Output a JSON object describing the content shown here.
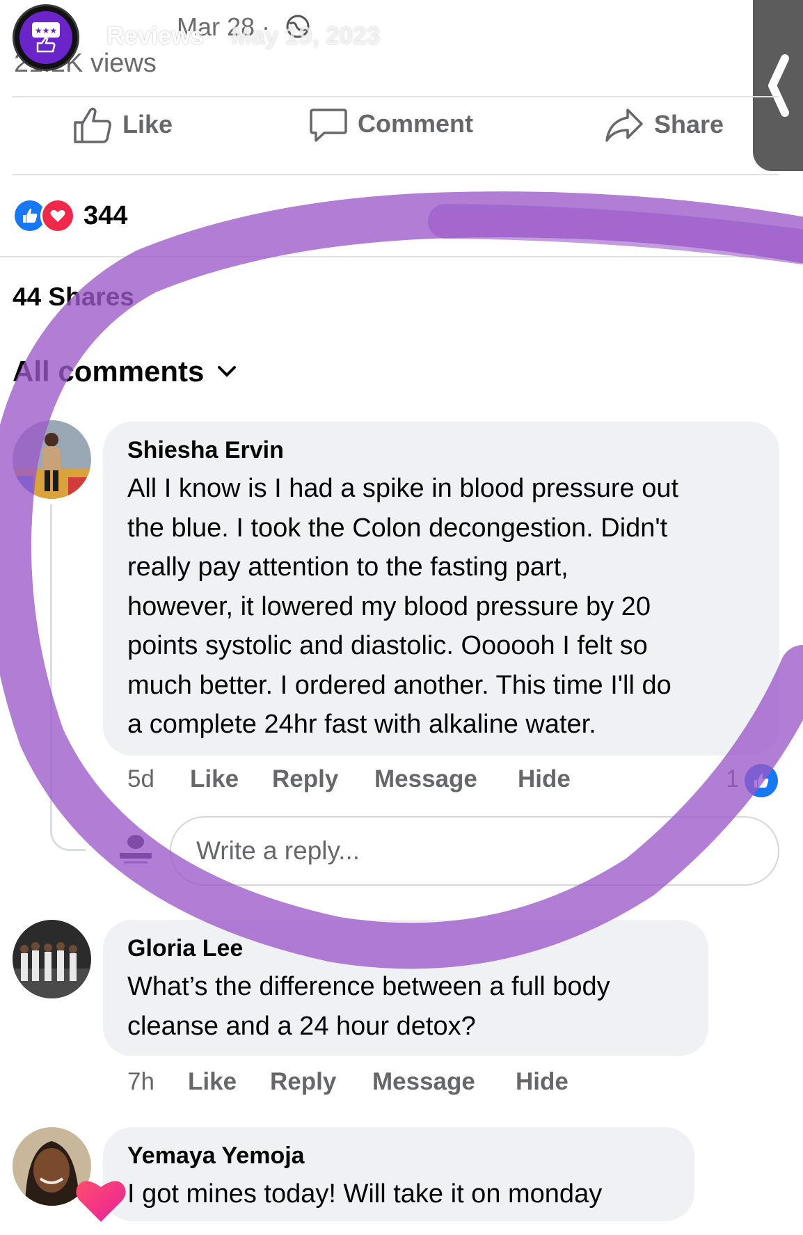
{
  "story": {
    "title": "Reviews",
    "date": "May 19, 2023",
    "faded_date": "Mar 28 ·",
    "faded_views": "21.2K views"
  },
  "post_actions": {
    "like": "Like",
    "comment": "Comment",
    "share": "Share"
  },
  "reactions": {
    "count": "344"
  },
  "shares": "44 Shares",
  "comments_filter": "All comments",
  "comments": [
    {
      "author": "Shiesha Ervin",
      "lines": [
        "All I know is I had a spike in blood pressure out",
        "the blue. I took the Colon decongestion. Didn't",
        "really pay attention to the fasting part,",
        "however, it lowered my blood pressure by 20",
        "points systolic and diastolic. Oooooh I felt so",
        "much better. I ordered another. This time I'll do",
        "a complete 24hr fast with alkaline water."
      ],
      "time": "5d",
      "like": "Like",
      "reply": "Reply",
      "message": "Message",
      "hide": "Hide",
      "like_count": "1"
    },
    {
      "author": "Gloria Lee",
      "lines": [
        "What’s the difference between a full body",
        "cleanse and a 24 hour detox?"
      ],
      "time": "7h",
      "like": "Like",
      "reply": "Reply",
      "message": "Message",
      "hide": "Hide"
    },
    {
      "author": "Yemaya Yemoja",
      "lines": [
        "I got mines today! Will take it on monday"
      ]
    }
  ],
  "reply_box": {
    "placeholder": "Write a reply..."
  },
  "colors": {
    "highlight": "#9b59c9",
    "like_blue": "#1877f2",
    "love_red": "#f02849",
    "heart_pink": "#ff3d7f"
  }
}
